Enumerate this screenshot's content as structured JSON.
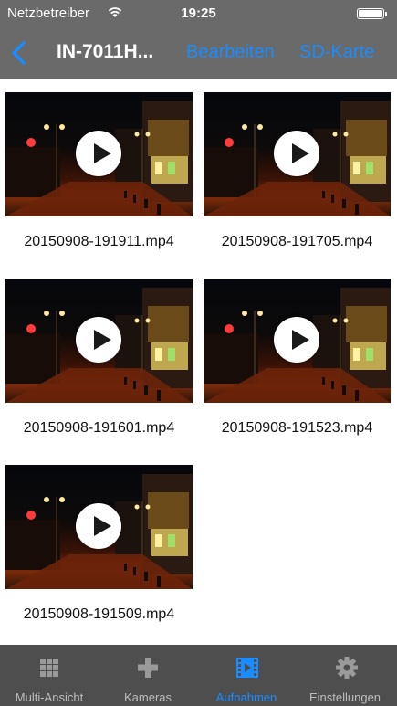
{
  "status_bar": {
    "carrier": "Netzbetreiber",
    "time": "19:25",
    "wifi_icon": "wifi-icon",
    "battery_icon": "battery-icon"
  },
  "nav_bar": {
    "back_icon": "chevron-left-icon",
    "title": "IN-7011H...",
    "edit_label": "Bearbeiten",
    "sd_card_label": "SD-Karte",
    "accent_color": "#1a8cff"
  },
  "recordings": [
    {
      "filename": "20150908-191911.mp4",
      "play_icon": "play-icon"
    },
    {
      "filename": "20150908-191705.mp4",
      "play_icon": "play-icon"
    },
    {
      "filename": "20150908-191601.mp4",
      "play_icon": "play-icon"
    },
    {
      "filename": "20150908-191523.mp4",
      "play_icon": "play-icon"
    },
    {
      "filename": "20150908-191509.mp4",
      "play_icon": "play-icon"
    }
  ],
  "tab_bar": {
    "tabs": [
      {
        "label": "Multi-Ansicht",
        "icon": "grid-icon",
        "active": false
      },
      {
        "label": "Kameras",
        "icon": "plus-icon",
        "active": false
      },
      {
        "label": "Aufnahmen",
        "icon": "film-icon",
        "active": true
      },
      {
        "label": "Einstellungen",
        "icon": "gear-icon",
        "active": false
      }
    ]
  }
}
